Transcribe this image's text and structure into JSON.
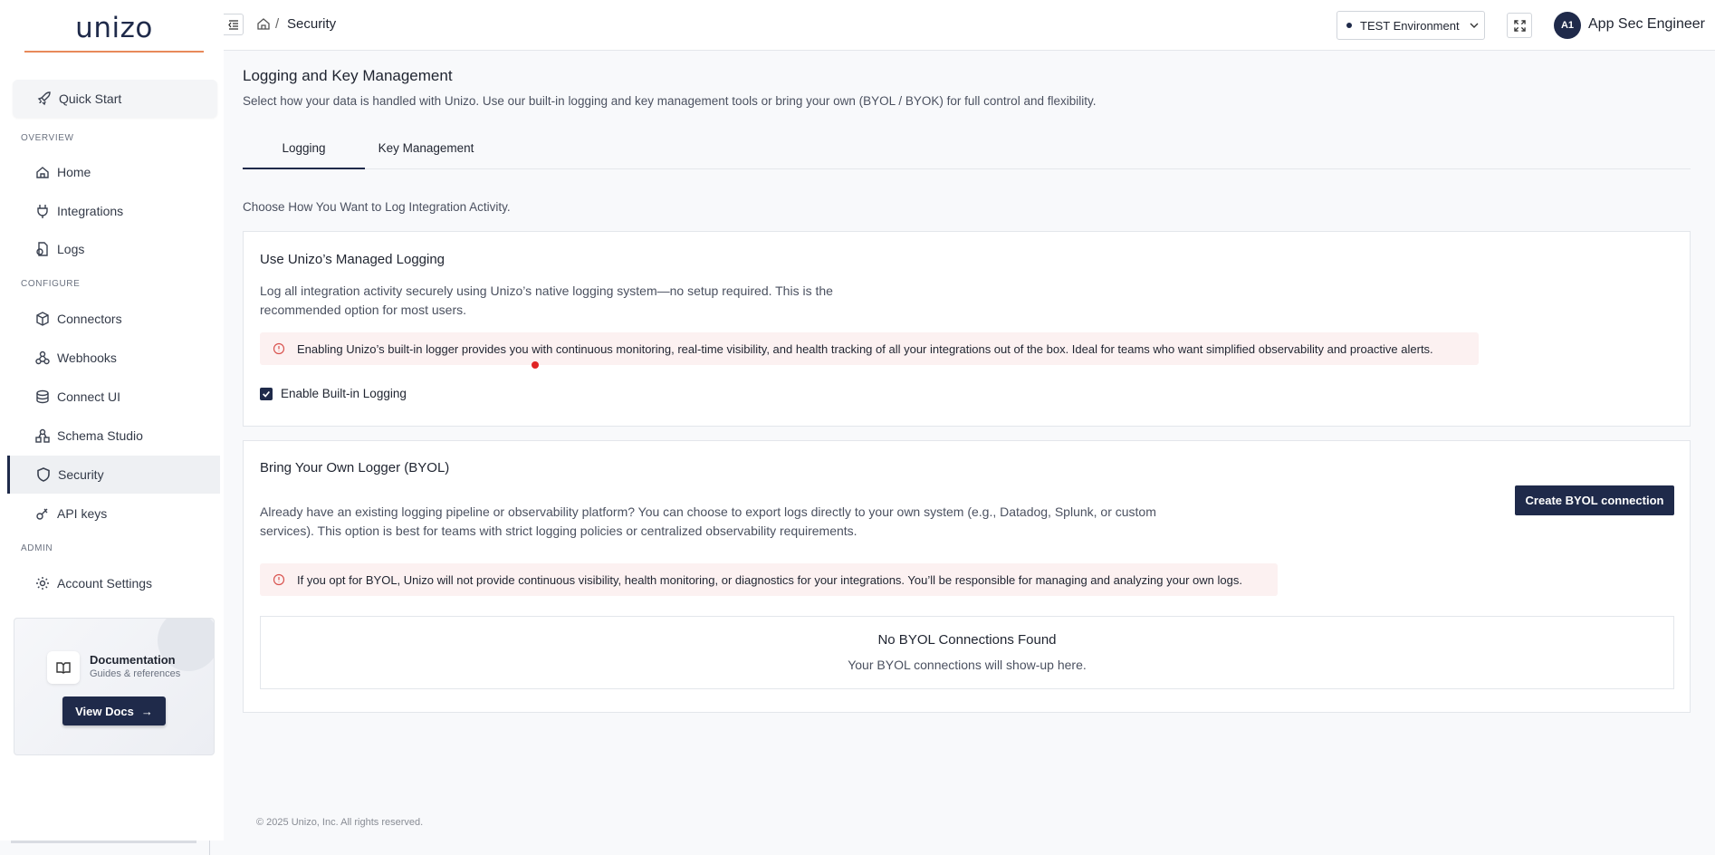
{
  "app": {
    "logo_text": "unizo"
  },
  "sidebar": {
    "quick_start": "Quick Start",
    "sections": {
      "overview": "OVERVIEW",
      "configure": "CONFIGURE",
      "admin": "ADMIN"
    },
    "items": [
      {
        "label": "Home",
        "icon": "home-icon"
      },
      {
        "label": "Integrations",
        "icon": "plug-icon"
      },
      {
        "label": "Logs",
        "icon": "logs-icon"
      },
      {
        "label": "Connectors",
        "icon": "box-icon"
      },
      {
        "label": "Webhooks",
        "icon": "webhook-icon"
      },
      {
        "label": "Connect UI",
        "icon": "layers-icon"
      },
      {
        "label": "Schema Studio",
        "icon": "schema-icon"
      },
      {
        "label": "Security",
        "icon": "shield-icon",
        "active": true
      },
      {
        "label": "API keys",
        "icon": "key-icon"
      },
      {
        "label": "Account Settings",
        "icon": "gear-icon"
      }
    ],
    "docs": {
      "title": "Documentation",
      "subtitle": "Guides & references",
      "button": "View Docs",
      "button_arrow": "→"
    }
  },
  "header": {
    "breadcrumb_sep": "/",
    "breadcrumb_current": "Security",
    "environment": "TEST Environment",
    "avatar_initials": "A1",
    "user_name": "App Sec Engineer"
  },
  "main": {
    "title": "Logging and Key Management",
    "description": "Select how your data is handled with Unizo. Use our built-in logging and key management tools or bring your own (BYOL / BYOK) for full control and flexibility.",
    "tabs": [
      {
        "label": "Logging",
        "active": true
      },
      {
        "label": "Key Management",
        "active": false
      }
    ],
    "choose_text": "Choose How You Want to Log Integration Activity.",
    "managed": {
      "title": "Use Unizo’s Managed Logging",
      "text_line1": "Log all integration activity securely using Unizo’s native logging system—no setup required. This is the",
      "text_line2": "recommended option for most users.",
      "alert": "Enabling Unizo’s built-in logger provides you with continuous monitoring, real-time visibility, and health tracking of all your integrations out of the box. Ideal for teams who want simplified observability and proactive alerts.",
      "checkbox_label": "Enable Built-in Logging",
      "checkbox_checked": true
    },
    "byol": {
      "title": "Bring Your Own Logger (BYOL)",
      "button": "Create BYOL connection",
      "text_line1": "Already have an existing logging pipeline or observability platform? You can choose to export logs directly to your own system (e.g., Datadog, Splunk, or custom",
      "text_line2": "services). This option is best for teams with strict logging policies or centralized observability requirements.",
      "alert": "If you opt for BYOL, Unizo will not provide continuous visibility, health monitoring, or diagnostics for your integrations. You’ll be responsible for managing and analyzing your own logs.",
      "empty_title": "No BYOL Connections Found",
      "empty_subtitle": "Your BYOL connections will show-up here."
    }
  },
  "footer": {
    "copyright": "© 2025 Unizo, Inc. All rights reserved."
  },
  "colors": {
    "brand": "#1f2a4a",
    "accent_line": "#e8895a",
    "alert_bg": "#fcf1f1",
    "alert_icon": "#d9534f"
  }
}
